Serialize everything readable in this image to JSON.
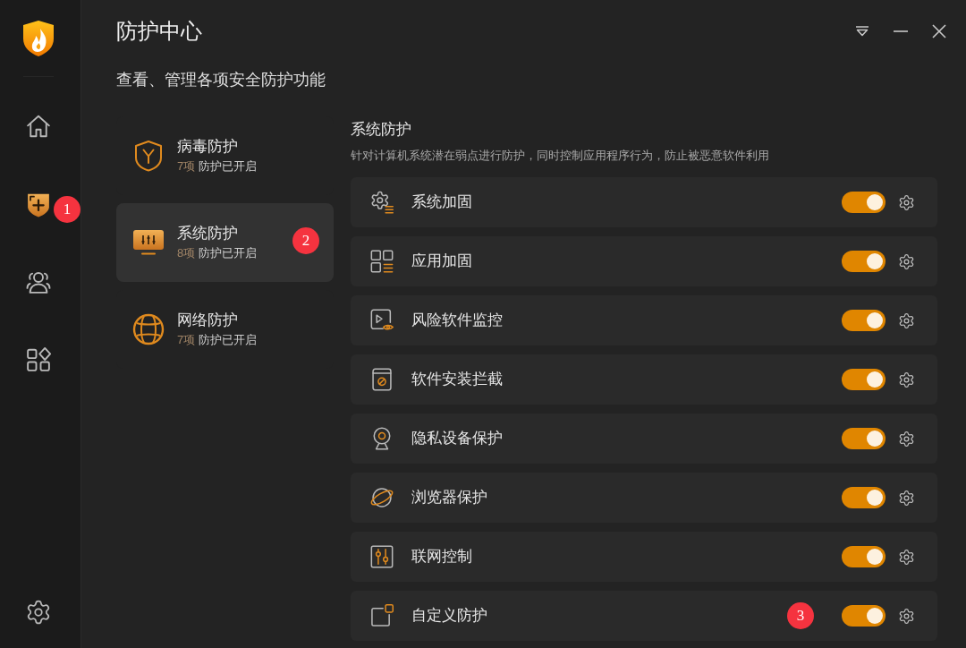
{
  "sidebar": {
    "items": [
      {
        "kind": "home",
        "selected": false
      },
      {
        "kind": "protection",
        "selected": true,
        "callout": "1"
      },
      {
        "kind": "users",
        "selected": false
      },
      {
        "kind": "apps",
        "selected": false
      }
    ],
    "bottom_items": [
      {
        "kind": "settings",
        "selected": false
      }
    ]
  },
  "window": {
    "title": "防护中心"
  },
  "subtitle": "查看、管理各项安全防护功能",
  "categories": [
    {
      "kind": "virus",
      "name": "病毒防护",
      "count": "7项",
      "status": "防护已开启",
      "selected": false
    },
    {
      "kind": "system",
      "name": "系统防护",
      "count": "8项",
      "status": "防护已开启",
      "selected": true,
      "callout": "2"
    },
    {
      "kind": "network",
      "name": "网络防护",
      "count": "7项",
      "status": "防护已开启",
      "selected": false
    }
  ],
  "panel": {
    "title": "系统防护",
    "description": "针对计算机系统潜在弱点进行防护，同时控制应用程序行为，防止被恶意软件利用",
    "items": [
      {
        "kind": "hardening",
        "name": "系统加固",
        "on": true
      },
      {
        "kind": "app",
        "name": "应用加固",
        "on": true
      },
      {
        "kind": "risk",
        "name": "风险软件监控",
        "on": true
      },
      {
        "kind": "install",
        "name": "软件安装拦截",
        "on": true
      },
      {
        "kind": "privacy",
        "name": "隐私设备保护",
        "on": true
      },
      {
        "kind": "browser",
        "name": "浏览器保护",
        "on": true
      },
      {
        "kind": "network",
        "name": "联网控制",
        "on": true
      },
      {
        "kind": "custom",
        "name": "自定义防护",
        "on": true,
        "callout": "3"
      }
    ]
  }
}
